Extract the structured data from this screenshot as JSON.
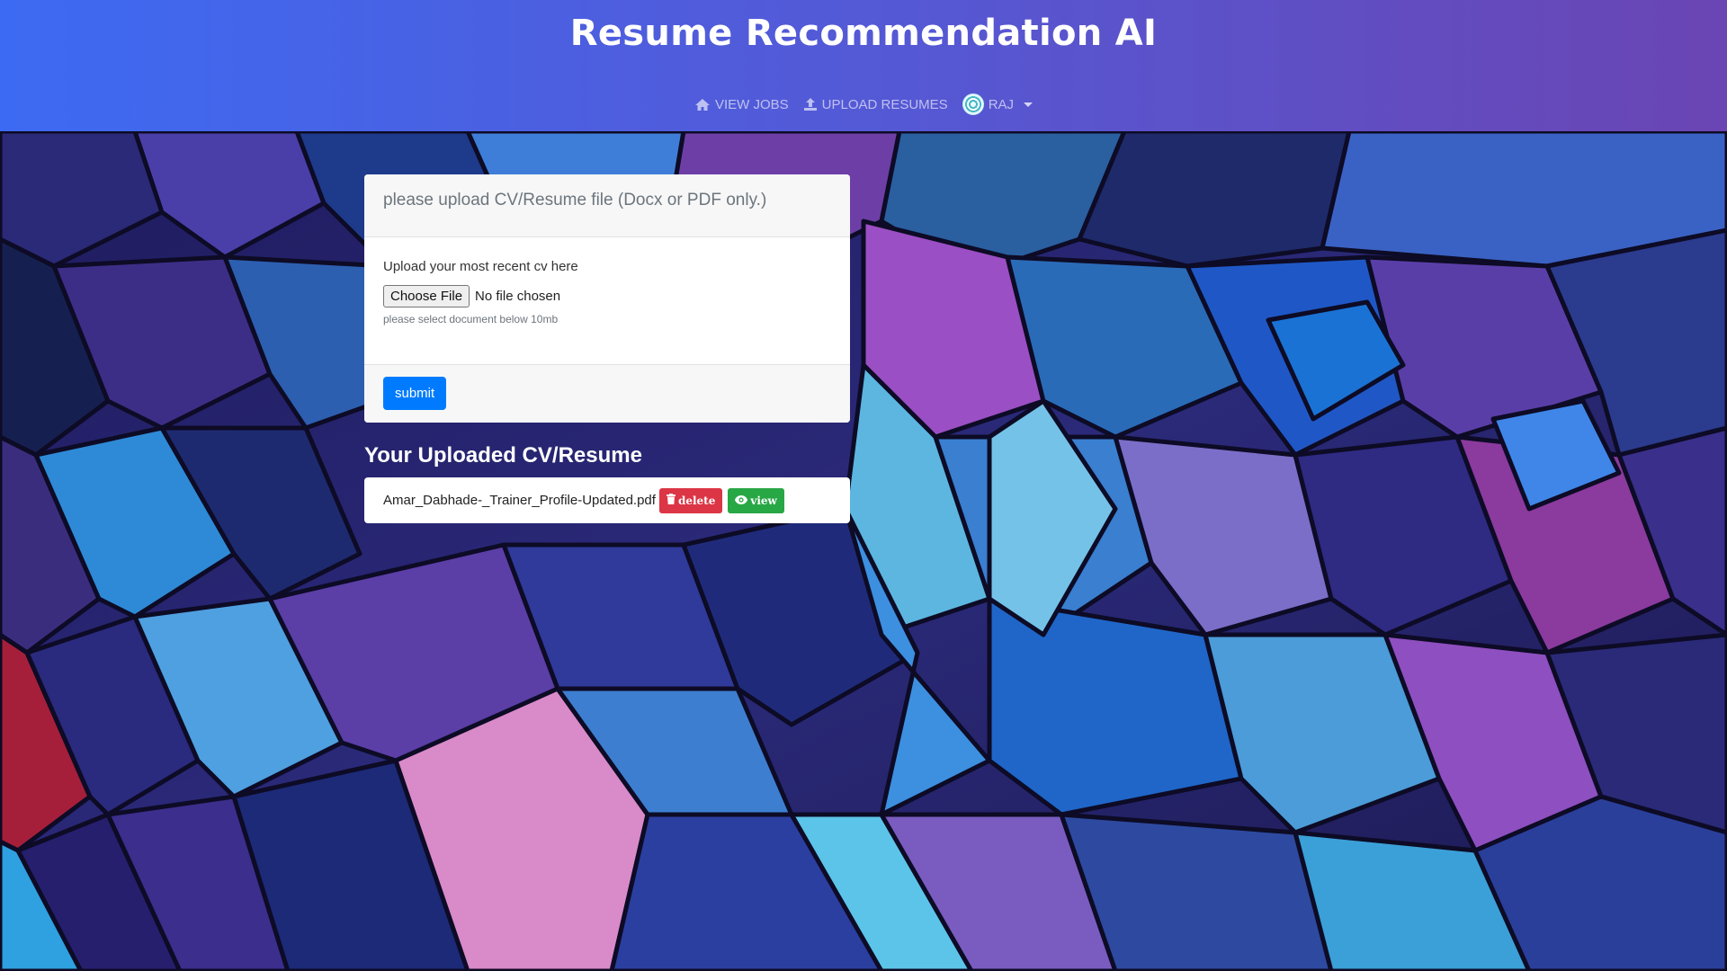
{
  "header": {
    "brand": "Resume Recommendation AI",
    "nav": {
      "view_jobs": "VIEW JOBS",
      "upload_resumes": "UPLOAD RESUMES",
      "user": "RAJ"
    }
  },
  "upload_card": {
    "header_text": "please upload CV/Resume file (Docx or PDF only.)",
    "label": "Upload your most recent cv here",
    "choose_file_button": "Choose File",
    "file_status": "No file chosen",
    "helper": "please select document below 10mb",
    "submit_label": "submit"
  },
  "uploaded_section": {
    "title": "Your Uploaded CV/Resume",
    "files": [
      {
        "name": "Amar_Dabhade-_Trainer_Profile-Updated.pdf",
        "delete_label": "delete",
        "view_label": "view"
      }
    ]
  },
  "colors": {
    "header_gradient_start": "#3d6af2",
    "header_gradient_end": "#6a45b3",
    "submit": "#007bff",
    "delete": "#dc3545",
    "view": "#28a745"
  },
  "icons": {
    "view_jobs": "home-icon",
    "upload_resumes": "upload-icon",
    "user": "avatar",
    "delete": "trash-icon",
    "view": "eye-icon"
  }
}
